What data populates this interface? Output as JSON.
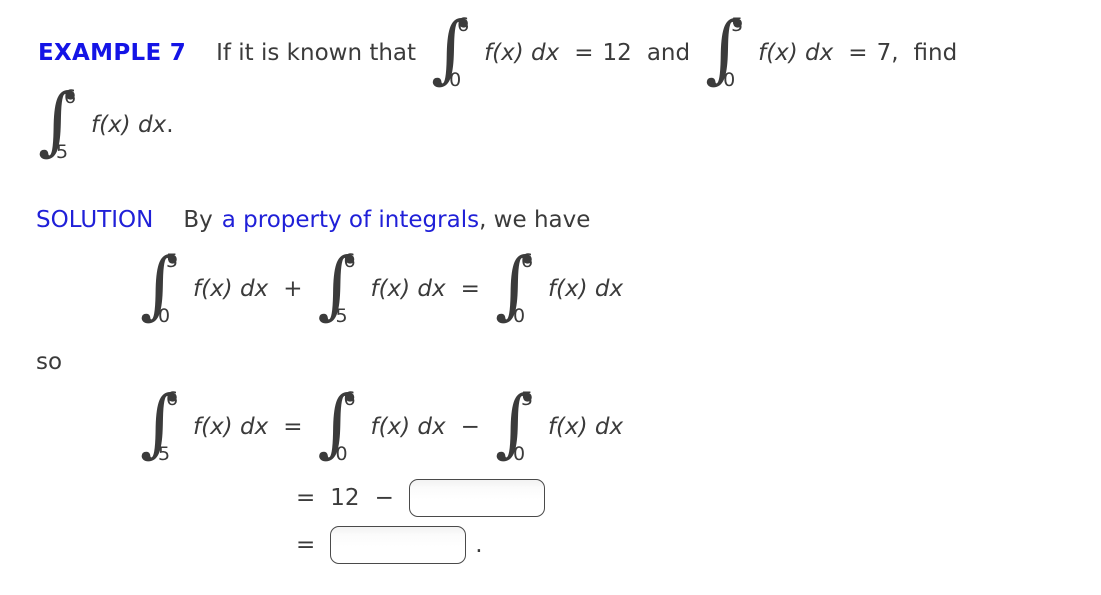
{
  "example": {
    "label": "EXAMPLE 7",
    "prompt_lead": "If it is known that",
    "given1": {
      "lower": "0",
      "upper": "6",
      "integrand": "f(x) dx",
      "eq": "=",
      "value": "12"
    },
    "conjunction": "and",
    "given2": {
      "lower": "0",
      "upper": "5",
      "integrand": "f(x) dx",
      "eq": "=",
      "value": "7,"
    },
    "prompt_tail": "find",
    "target": {
      "lower": "5",
      "upper": "6",
      "integrand": "f(x) dx",
      "period": "."
    }
  },
  "solution": {
    "heading": "SOLUTION",
    "text_before_link": "By",
    "link_text": "a property of integrals",
    "text_after_link": ", we have",
    "so_text": "so",
    "equation1": {
      "term1": {
        "lower": "0",
        "upper": "5",
        "integrand": "f(x) dx"
      },
      "op1": "+",
      "term2": {
        "lower": "5",
        "upper": "6",
        "integrand": "f(x) dx"
      },
      "op2": "=",
      "term3": {
        "lower": "0",
        "upper": "6",
        "integrand": "f(x) dx"
      }
    },
    "equation2": {
      "term1": {
        "lower": "5",
        "upper": "6",
        "integrand": "f(x) dx"
      },
      "op1": "=",
      "term2": {
        "lower": "0",
        "upper": "6",
        "integrand": "f(x) dx"
      },
      "op2": "−",
      "term3": {
        "lower": "0",
        "upper": "5",
        "integrand": "f(x) dx"
      }
    },
    "equation3": {
      "eq": "=",
      "number": "12",
      "minus": "−",
      "answer_value": "",
      "answer_placeholder": ""
    },
    "equation4": {
      "eq": "=",
      "answer_value": "",
      "answer_placeholder": "",
      "period": "."
    }
  },
  "symbols": {
    "integral_glyph": "∫"
  },
  "colors": {
    "heading_blue": "#1414e6",
    "link_blue": "#2020d8",
    "body_gray": "#3b3b3b",
    "box_border": "#4a4a4a",
    "background": "#ffffff"
  }
}
